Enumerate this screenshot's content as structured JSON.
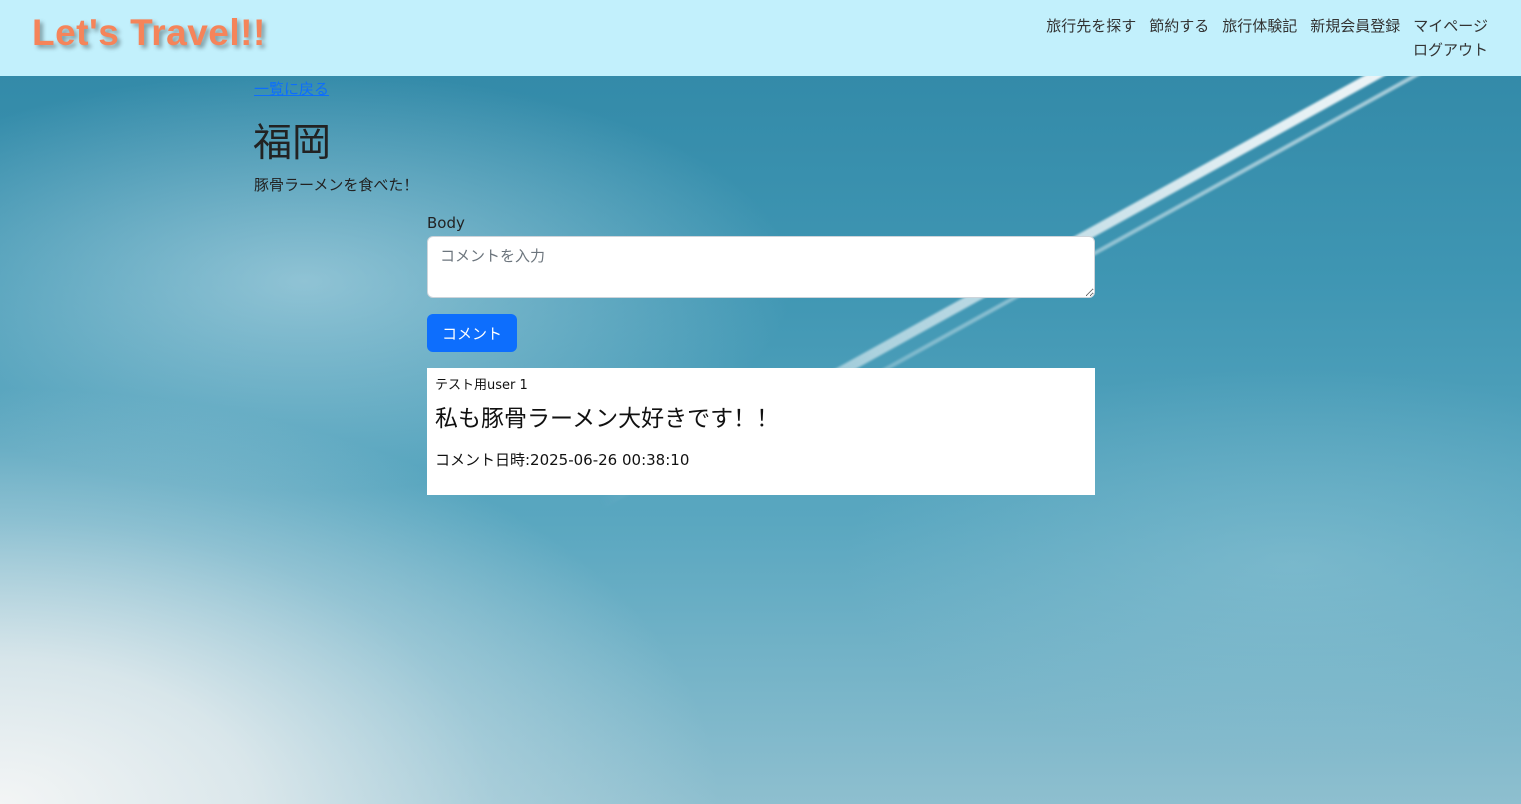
{
  "header": {
    "brand": "Let's Travel!!",
    "nav": {
      "find_destination": "旅行先を探す",
      "save_money": "節約する",
      "travel_diary": "旅行体験記",
      "signup": "新規会員登録",
      "mypage": "マイページ",
      "logout": "ログアウト"
    }
  },
  "main": {
    "back_link": "一覧に戻る",
    "title": "福岡",
    "description": "豚骨ラーメンを食べた！"
  },
  "comment_form": {
    "label": "Body",
    "placeholder": "コメントを入力",
    "submit_label": "コメント"
  },
  "comments": [
    {
      "user": "テスト用user 1",
      "body": "私も豚骨ラーメン大好きです！！",
      "date": "コメント日時:2025-06-26 00:38:10"
    }
  ],
  "colors": {
    "header_bg": "#c2f0fc",
    "brand": "#f5845a",
    "primary_button": "#0d6efd"
  }
}
